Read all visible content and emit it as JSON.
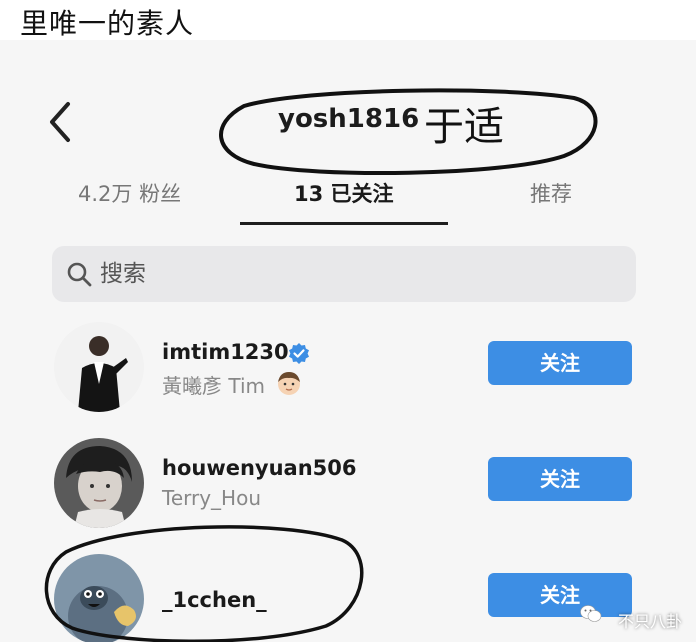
{
  "caption": {
    "text": "里唯一的素人"
  },
  "header": {
    "back_icon": "chevron-left-icon",
    "username": "yosh1816",
    "display_name": "于适"
  },
  "tabs": [
    {
      "label": "4.2万 粉丝",
      "active": false
    },
    {
      "label": "13 已关注",
      "active": true
    },
    {
      "label": "推荐",
      "active": false
    }
  ],
  "search": {
    "placeholder": "搜索",
    "value": "",
    "icon": "search-icon"
  },
  "following": [
    {
      "username": "imtim1230",
      "subname": "黃曦彥 Tim",
      "verified": true,
      "emoji": "face-emoji-icon",
      "button_label": "关注"
    },
    {
      "username": "houwenyuan506",
      "subname": "Terry_Hou",
      "verified": false,
      "button_label": "关注"
    },
    {
      "username": "_1cchen_",
      "subname": "",
      "verified": false,
      "button_label": "关注"
    }
  ],
  "watermark": {
    "text": "不只八卦"
  },
  "colors": {
    "accent": "#3d8ee4",
    "verified": "#3d8ee4",
    "annotation": "#111111",
    "background": "#f6f6f6"
  }
}
